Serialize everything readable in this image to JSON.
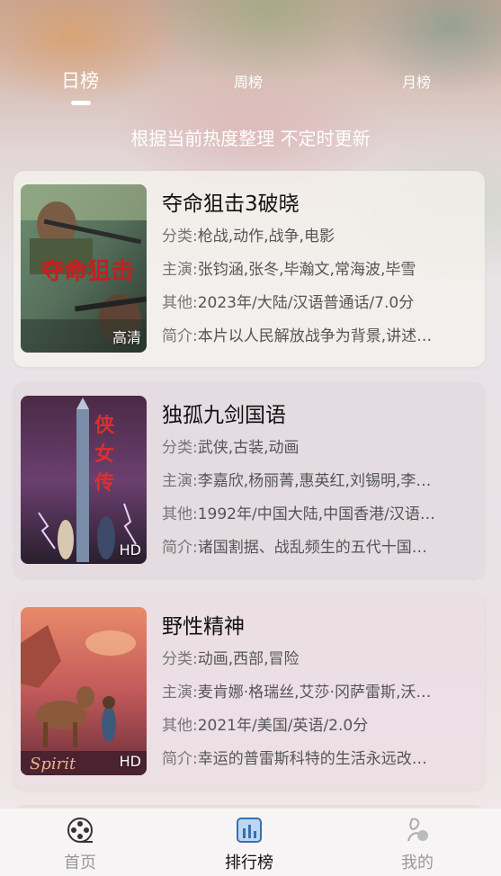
{
  "tabs": [
    {
      "label": "日榜",
      "active": true
    },
    {
      "label": "周榜",
      "active": false
    },
    {
      "label": "月榜",
      "active": false
    }
  ],
  "subtitle": "根据当前热度整理 不定时更新",
  "movies": [
    {
      "title": "夺命狙击3破晓",
      "badge": "高清",
      "category_label": "分类:",
      "category": "枪战,动作,战争,电影",
      "cast_label": "主演:",
      "cast": "张钧涵,张冬,毕瀚文,常海波,毕雪",
      "other_label": "其他:",
      "other": "2023年/大陆/汉语普通话/7.0分",
      "intro_label": "简介:",
      "intro": "本片以人民解放战争为背景,讲述…"
    },
    {
      "title": "独孤九剑国语",
      "badge": "HD",
      "category_label": "分类:",
      "category": "武侠,古装,动画",
      "cast_label": "主演:",
      "cast": "李嘉欣,杨丽菁,惠英红,刘锡明,李…",
      "other_label": "其他:",
      "other": "1992年/中国大陆,中国香港/汉语…",
      "intro_label": "简介:",
      "intro": "诸国割据、战乱频生的五代十国…"
    },
    {
      "title": "野性精神",
      "badge": "HD",
      "category_label": "分类:",
      "category": "动画,西部,冒险",
      "cast_label": "主演:",
      "cast": "麦肯娜·格瑞丝,艾莎·冈萨雷斯,沃…",
      "other_label": "其他:",
      "other": "2021年/美国/英语/2.0分",
      "intro_label": "简介:",
      "intro": "幸运的普雷斯科特的生活永远改…"
    }
  ],
  "bottom_nav": [
    {
      "label": "首页",
      "icon": "film-reel-icon",
      "active": false
    },
    {
      "label": "排行榜",
      "icon": "bar-chart-icon",
      "active": true
    },
    {
      "label": "我的",
      "icon": "user-profile-icon",
      "active": false
    }
  ]
}
